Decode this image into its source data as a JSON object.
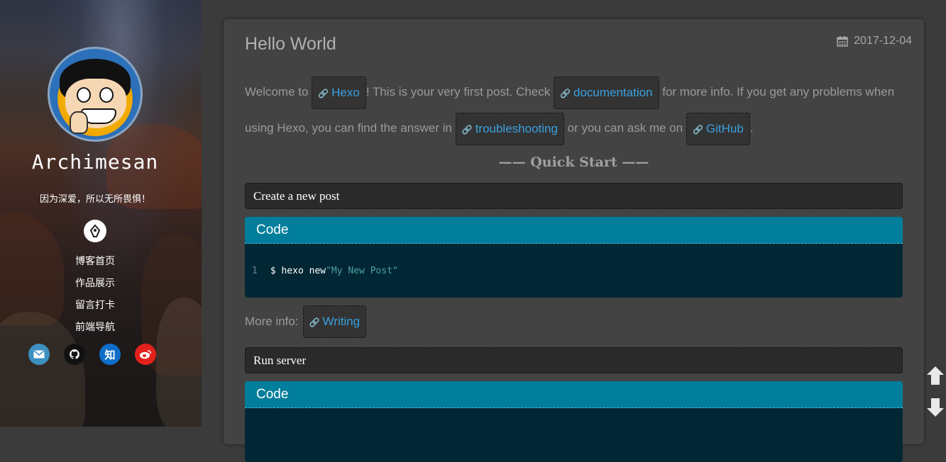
{
  "sidebar": {
    "author": "Archimesan",
    "motto": "因为深爱，所以无所畏惧！",
    "nav": [
      "博客首页",
      "作品展示",
      "留言打卡",
      "前端导航"
    ],
    "social_zhihu": "知"
  },
  "post": {
    "title": "Hello World",
    "date": "2017-12-04",
    "intro_1": "Welcome to ",
    "link_hexo": "Hexo",
    "intro_2": "! This is your very first post. Check ",
    "link_docs": "documentation",
    "intro_3": " for more info. If you get any problems when using Hexo, you can find the answer in ",
    "link_trouble": "troubleshooting",
    "intro_4": " or you can ask me on ",
    "link_github": "GitHub",
    "intro_5": ".",
    "section_title": "—— Quick Start ——",
    "step1_title": "Create a new post",
    "code_label": "Code",
    "code1_line": "1",
    "code1_cmd": "$ hexo new ",
    "code1_str": "\"My New Post\"",
    "more_info_label": "More info:",
    "link_writing": "Writing",
    "step2_title": "Run server",
    "code2_label": "Code"
  },
  "colors": {
    "link": "#3aa0df",
    "code_header": "#017e9b",
    "code_bg": "#012734"
  }
}
